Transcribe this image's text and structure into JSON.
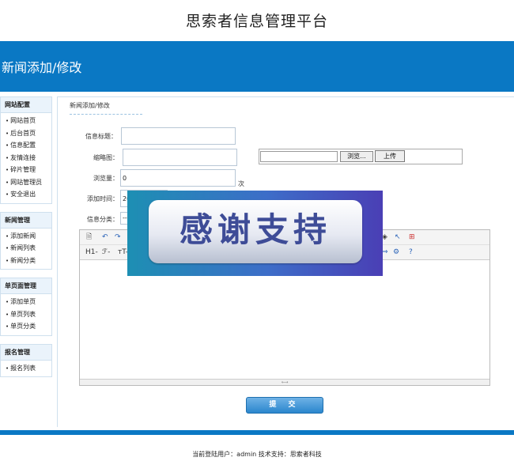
{
  "site": {
    "title": "思索者信息管理平台"
  },
  "header": {
    "title": "新闻添加/修改"
  },
  "sidebar": {
    "groups": [
      {
        "title": "网站配置",
        "items": [
          "网站首页",
          "后台首页",
          "信息配置",
          "友情连接",
          "碎片管理",
          "网站管理员",
          "安全退出"
        ]
      },
      {
        "title": "新闻管理",
        "items": [
          "添加新闻",
          "新闻列表",
          "新闻分类"
        ]
      },
      {
        "title": "单页面管理",
        "items": [
          "添加单页",
          "单页列表",
          "单页分类"
        ]
      },
      {
        "title": "报名管理",
        "items": [
          "报名列表"
        ]
      }
    ]
  },
  "main": {
    "breadcrumb": "新闻添加/修改",
    "form": {
      "title_label": "信息标题：",
      "title_value": "",
      "thumb_label": "缩略图：",
      "thumb_value": "",
      "browse_label": "浏览...",
      "upload_label": "上传",
      "views_label": "浏览量：",
      "views_value": "0",
      "views_unit": "次",
      "addtime_label": "添加时间：",
      "addtime_value": "20",
      "category_label": "信息分类：",
      "category_value": "--"
    },
    "editor": {
      "toolbar_row1": [
        "source-icon",
        "undo-icon",
        "redo-icon",
        "preview-icon",
        "link-icon",
        "table-icon"
      ],
      "toolbar_row2": [
        "H1-",
        "ℱ-",
        "тT-",
        "redo-format-icon",
        "image-icon",
        "help-icon"
      ]
    },
    "submit_label": "提 交"
  },
  "overlay": {
    "text": "感谢支持"
  },
  "footer": {
    "text": "当前登陆用户：admin  技术支持：思索者科技"
  },
  "colors": {
    "header_blue": "#0a78c4",
    "button_blue": "#2a86cd",
    "overlay_text": "#3e4c97"
  }
}
